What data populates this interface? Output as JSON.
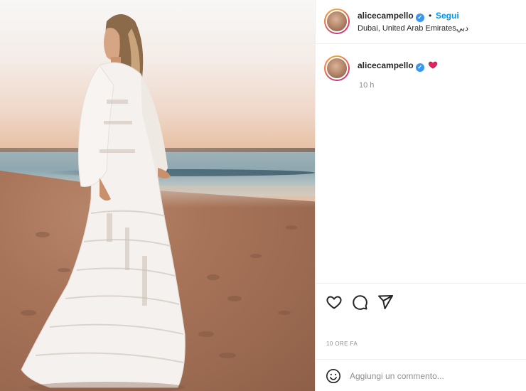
{
  "post": {
    "author": "alicecampello",
    "verified": true,
    "follow_label": "Segui",
    "separator": "•",
    "location": "Dubai, United Arab Emiratesدبي"
  },
  "caption": {
    "author": "alicecampello",
    "emoji": "heart-emoji",
    "time": "10 h"
  },
  "actions": {
    "icons": [
      "heart-icon",
      "comment-icon",
      "share-icon"
    ]
  },
  "timestamp": "10 ORE FA",
  "comment": {
    "placeholder": "Aggiungi un commento..."
  },
  "colors": {
    "accent": "#0095f6",
    "verified": "#3897f0",
    "heart": "#e0245e"
  }
}
